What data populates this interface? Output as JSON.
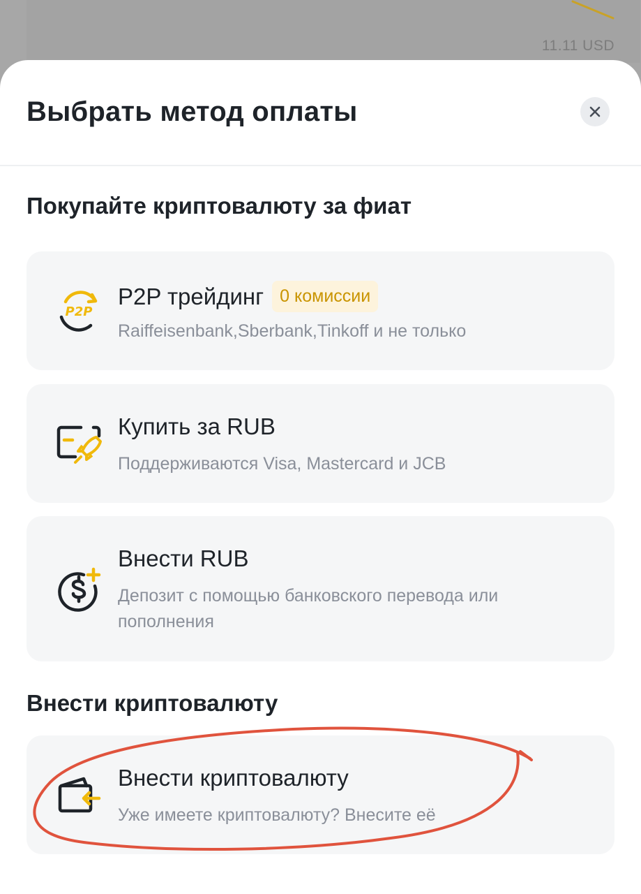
{
  "backdrop": {
    "amount": "11.11 USD"
  },
  "sheet": {
    "title": "Выбрать метод оплаты"
  },
  "sections": [
    {
      "title": "Покупайте криптовалюту за фиат",
      "items": [
        {
          "title": "P2P трейдинг",
          "badge": "0 комиссии",
          "subtitle": "Raiffeisenbank,Sberbank,Tinkoff и не только",
          "icon": "p2p-icon",
          "icon_text": "P2P"
        },
        {
          "title": "Купить за RUB",
          "subtitle": "Поддерживаются Visa, Mastercard и JCB",
          "icon": "card-rocket-icon"
        },
        {
          "title": "Внести RUB",
          "subtitle": "Депозит с помощью банковского перевода или пополнения",
          "icon": "dollar-plus-icon"
        }
      ]
    },
    {
      "title": "Внести криптовалюту",
      "items": [
        {
          "title": "Внести криптовалюту",
          "subtitle": "Уже имеете криптовалюту? Внесите её",
          "icon": "wallet-deposit-icon"
        }
      ]
    }
  ],
  "colors": {
    "accent": "#F0B90B",
    "text_primary": "#1E2329",
    "text_secondary": "#8A8F99",
    "card_bg": "#F5F6F7",
    "badge_bg": "#FDF3DC",
    "badge_text": "#C99400",
    "annotation": "#E0533D"
  }
}
